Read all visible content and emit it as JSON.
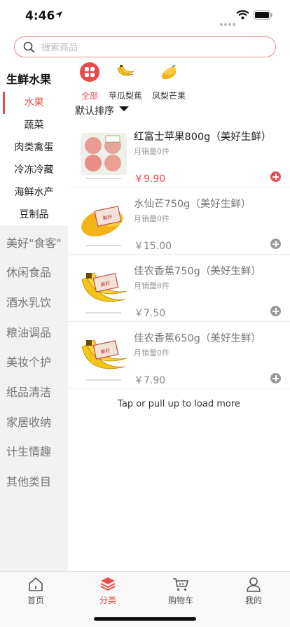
{
  "status_bar": {
    "time": "4:46"
  },
  "search": {
    "placeholder": "搜索商品"
  },
  "sidebar": {
    "heading": "生鲜水果",
    "sub_items": [
      "水果",
      "蔬菜",
      "肉类禽蛋",
      "冷冻冷藏",
      "海鲜水产",
      "豆制品"
    ],
    "active_sub": "水果",
    "categories": [
      "美好\"食客\"",
      "休闲食品",
      "酒水乳饮",
      "粮油调品",
      "美妆个护",
      "纸品清洁",
      "家居收纳",
      "计生情趣",
      "其他类目"
    ]
  },
  "top_categories": [
    {
      "label": "全部",
      "icon": "grid-icon"
    },
    {
      "label": "苹瓜梨蕉",
      "icon": "banana-icon"
    },
    {
      "label": "凤梨芒果",
      "icon": "mango-icon"
    }
  ],
  "sort": {
    "label": "默认排序"
  },
  "products": [
    {
      "name": "红富士苹果800g（美好生鲜）",
      "sales": "月销量0件",
      "price": "￥9.90",
      "image": "apple-pack-image"
    },
    {
      "name": "水仙芒750g（美好生鲜）",
      "sales": "月销量0件",
      "price": "￥15.00",
      "image": "mango-image"
    },
    {
      "name": "佳农香蕉750g（美好生鲜）",
      "sales": "月销量8件",
      "price": "￥7.50",
      "image": "banana-image"
    },
    {
      "name": "佳农香蕉650g（美好生鲜）",
      "sales": "月销量0件",
      "price": "￥7.90",
      "image": "banana-image"
    }
  ],
  "load_more": "Tap or pull up to load more",
  "tabbar": {
    "items": [
      {
        "label": "首页",
        "icon": "home-icon"
      },
      {
        "label": "分类",
        "icon": "layers-icon"
      },
      {
        "label": "购物车",
        "icon": "cart-icon"
      },
      {
        "label": "我的",
        "icon": "user-icon"
      }
    ],
    "active": "分类"
  },
  "colors": {
    "accent": "#e74c4c",
    "sidebar_bg": "#f2f2f2",
    "search_border": "#e58a8a"
  }
}
